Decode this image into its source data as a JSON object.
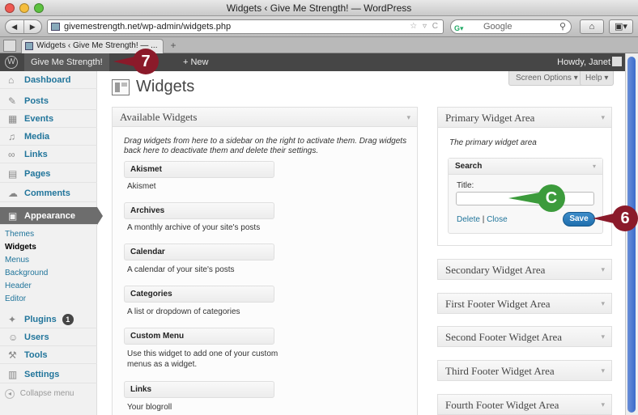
{
  "browser": {
    "window_title": "Widgets ‹ Give Me Strength! — WordPress",
    "url": "givemestrength.net/wp-admin/widgets.php",
    "search_engine": "Google",
    "tab_title": "Widgets ‹ Give Me Strength! — ...",
    "new_tab": "+",
    "back_glyph": "◀",
    "forward_glyph": "▶",
    "url_actions": "☆ ▿ C",
    "search_glyph": "⚲",
    "home_glyph": "⌂",
    "ext_glyph": "▣▾"
  },
  "adminbar": {
    "logo_glyph": "W",
    "site_name": "Give Me Strength!",
    "new_label": "+ New",
    "howdy": "Howdy, Janet"
  },
  "sidebar": {
    "items": [
      {
        "label": "Dashboard",
        "icon": "⌂"
      },
      {
        "label": "Posts",
        "icon": "✎"
      },
      {
        "label": "Events",
        "icon": "▦"
      },
      {
        "label": "Media",
        "icon": "♫"
      },
      {
        "label": "Links",
        "icon": "∞"
      },
      {
        "label": "Pages",
        "icon": "▤"
      },
      {
        "label": "Comments",
        "icon": "☁"
      },
      {
        "label": "Appearance",
        "icon": "▣"
      }
    ],
    "submenu": [
      "Themes",
      "Widgets",
      "Menus",
      "Background",
      "Header",
      "Editor"
    ],
    "lower_items": [
      {
        "label": "Plugins",
        "icon": "✦",
        "badge": "1"
      },
      {
        "label": "Users",
        "icon": "☺"
      },
      {
        "label": "Tools",
        "icon": "⚒"
      },
      {
        "label": "Settings",
        "icon": "▥"
      }
    ],
    "collapse_label": "Collapse menu",
    "collapse_glyph": "◂"
  },
  "main": {
    "title": "Widgets",
    "screen_options": "Screen Options ▾",
    "help": "Help ▾",
    "chevron": "▾",
    "available": {
      "heading": "Available Widgets",
      "description": "Drag widgets from here to a sidebar on the right to activate them. Drag widgets back here to deactivate them and delete their settings.",
      "widgets": [
        {
          "name": "Akismet",
          "desc": "Akismet"
        },
        {
          "name": "Archives",
          "desc": "A monthly archive of your site's posts"
        },
        {
          "name": "Calendar",
          "desc": "A calendar of your site's posts"
        },
        {
          "name": "Categories",
          "desc": "A list or dropdown of categories"
        },
        {
          "name": "Custom Menu",
          "desc": "Use this widget to add one of your custom menus as a widget."
        },
        {
          "name": "Links",
          "desc": "Your blogroll"
        }
      ]
    },
    "primary": {
      "heading": "Primary Widget Area",
      "description": "The primary widget area",
      "search_widget": {
        "title": "Search",
        "field_label": "Title:",
        "field_value": "",
        "delete": "Delete",
        "separator": "|",
        "close": "Close",
        "save": "Save"
      }
    },
    "areas": [
      "Secondary Widget Area",
      "First Footer Widget Area",
      "Second Footer Widget Area",
      "Third Footer Widget Area",
      "Fourth Footer Widget Area"
    ]
  },
  "callouts": {
    "seven": "7",
    "six": "6",
    "c": "C"
  },
  "colors": {
    "callout_red": "#8b1a2a",
    "callout_green": "#3c9b3c",
    "admin_bar": "#464646",
    "link_blue": "#21759b",
    "save_blue": "#2a7dbd"
  }
}
